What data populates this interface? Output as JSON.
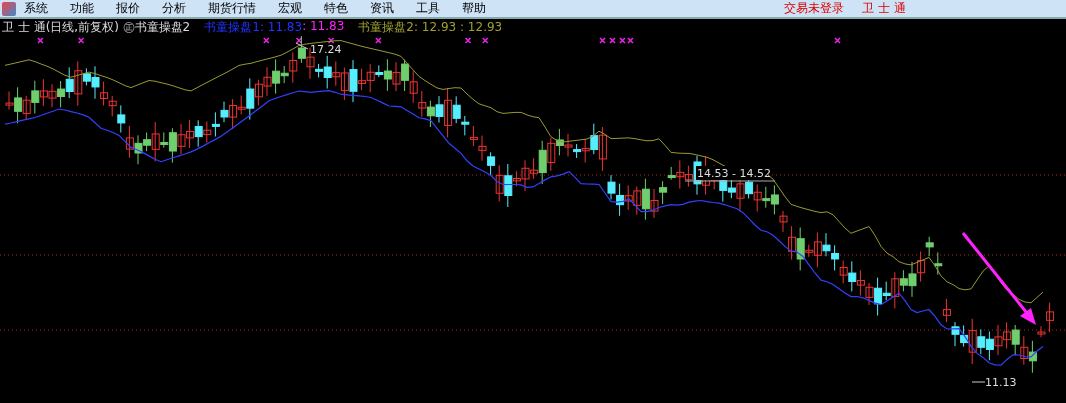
{
  "menu": {
    "items": [
      "系统",
      "功能",
      "报价",
      "分析",
      "期货行情",
      "宏观",
      "特色",
      "资讯",
      "工具",
      "帮助"
    ],
    "status": "交易未登录",
    "account": "卫 士 通"
  },
  "legend": {
    "title": "卫 士 通(日线,前复权) ㊣书童操盘2",
    "series": [
      {
        "parts": [
          "书童操盘1: 11.83",
          ": 11.83"
        ]
      },
      {
        "parts": [
          "书童操盘2: 12.93 : 12.93"
        ]
      }
    ]
  },
  "chart": {
    "high_label": "17.24",
    "range_label": "14.53 - 14.52",
    "low_label": "11.13"
  }
}
